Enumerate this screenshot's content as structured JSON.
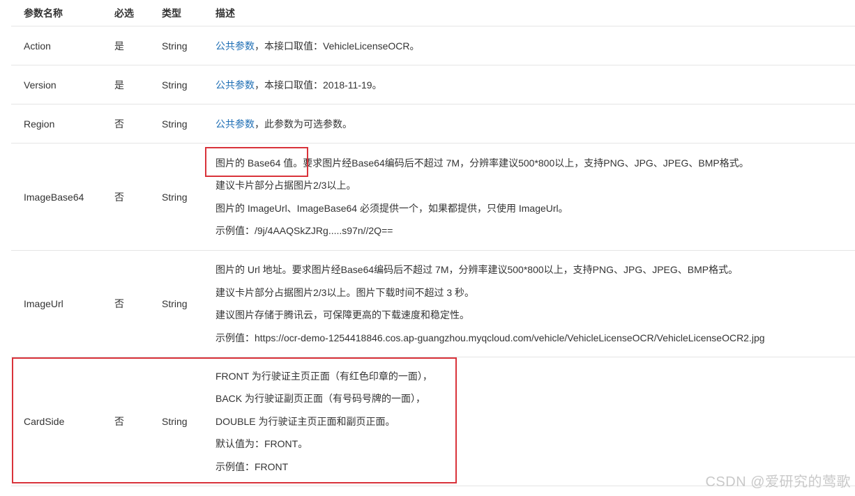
{
  "header": {
    "name": "参数名称",
    "required": "必选",
    "type": "类型",
    "desc": "描述"
  },
  "rows": [
    {
      "name": "Action",
      "required": "是",
      "type": "String",
      "desc_link": "公共参数",
      "desc_rest": "，本接口取值：VehicleLicenseOCR。"
    },
    {
      "name": "Version",
      "required": "是",
      "type": "String",
      "desc_link": "公共参数",
      "desc_rest": "，本接口取值：2018-11-19。"
    },
    {
      "name": "Region",
      "required": "否",
      "type": "String",
      "desc_link": "公共参数",
      "desc_rest": "，此参数为可选参数。"
    },
    {
      "name": "ImageBase64",
      "required": "否",
      "type": "String",
      "desc_lines": [
        "图片的 Base64 值。要求图片经Base64编码后不超过 7M，分辨率建议500*800以上，支持PNG、JPG、JPEG、BMP格式。",
        "建议卡片部分占据图片2/3以上。",
        "图片的 ImageUrl、ImageBase64 必须提供一个，如果都提供，只使用 ImageUrl。",
        "示例值：/9j/4AAQSkZJRg.....s97n//2Q=="
      ]
    },
    {
      "name": "ImageUrl",
      "required": "否",
      "type": "String",
      "desc_lines": [
        "图片的 Url 地址。要求图片经Base64编码后不超过 7M，分辨率建议500*800以上，支持PNG、JPG、JPEG、BMP格式。",
        "建议卡片部分占据图片2/3以上。图片下载时间不超过 3 秒。",
        "建议图片存储于腾讯云，可保障更高的下载速度和稳定性。",
        "示例值：https://ocr-demo-1254418846.cos.ap-guangzhou.myqcloud.com/vehicle/VehicleLicenseOCR/VehicleLicenseOCR2.jpg"
      ]
    },
    {
      "name": "CardSide",
      "required": "否",
      "type": "String",
      "desc_lines": [
        "FRONT 为行驶证主页正面（有红色印章的一面），",
        "BACK 为行驶证副页正面（有号码号牌的一面），",
        "DOUBLE 为行驶证主页正面和副页正面。",
        "默认值为：FRONT。",
        "示例值：FRONT"
      ]
    }
  ],
  "watermark": "CSDN @爱研究的莺歌",
  "colors": {
    "link": "#1f6fb5",
    "highlight": "#d9323a",
    "border": "#e5e5e5"
  }
}
